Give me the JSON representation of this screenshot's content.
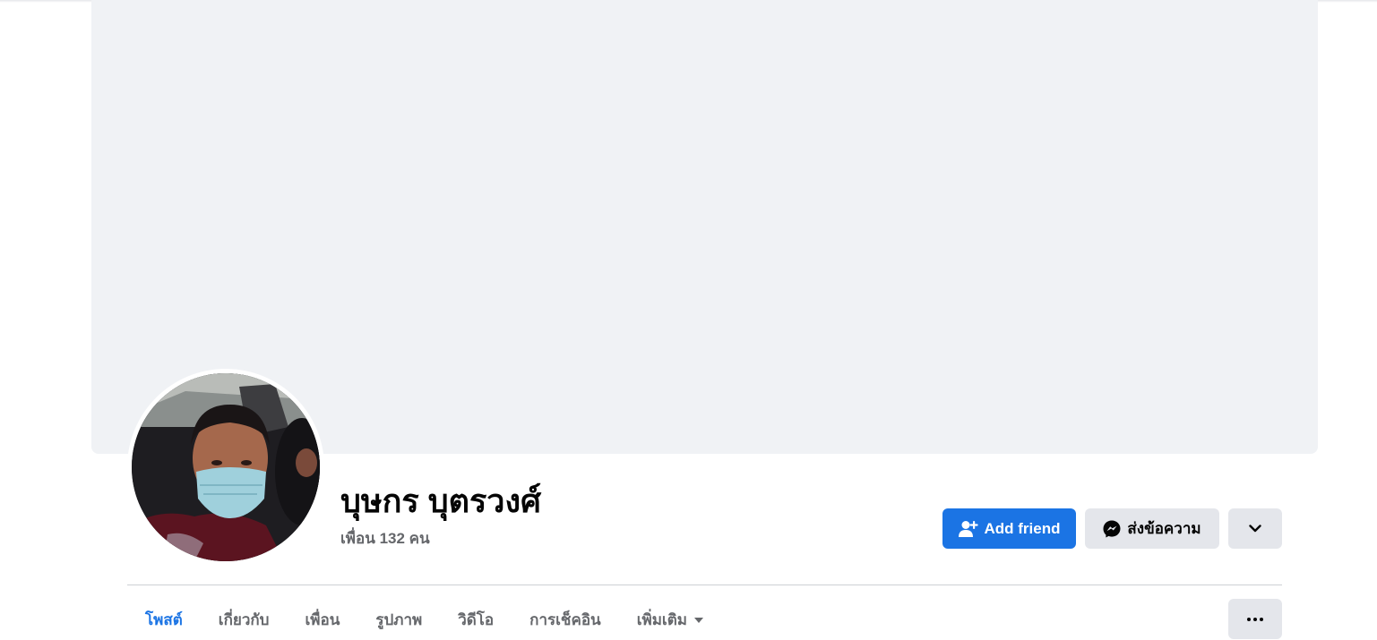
{
  "profile": {
    "name": "บุษกร บุตรวงศ์",
    "friends_count": "เพื่อน 132 คน"
  },
  "actions": {
    "add_friend_label": "Add friend",
    "message_label": "ส่งข้อความ"
  },
  "tabs": [
    {
      "label": "โพสต์",
      "active": true
    },
    {
      "label": "เกี่ยวกับ",
      "active": false
    },
    {
      "label": "เพื่อน",
      "active": false
    },
    {
      "label": "รูปภาพ",
      "active": false
    },
    {
      "label": "วิดีโอ",
      "active": false
    },
    {
      "label": "การเช็คอิน",
      "active": false
    },
    {
      "label": "เพิ่มเติม",
      "active": false
    }
  ],
  "colors": {
    "primary": "#1b74e4",
    "secondary_button": "#e4e6eb",
    "cover": "#f0f2f5",
    "muted_text": "#65676b"
  },
  "icons": {
    "add_friend": "person-plus-icon",
    "message": "messenger-icon",
    "profile_menu": "chevron-down-icon",
    "more_tab": "caret-down-icon",
    "tabs_menu": "ellipsis-icon"
  }
}
